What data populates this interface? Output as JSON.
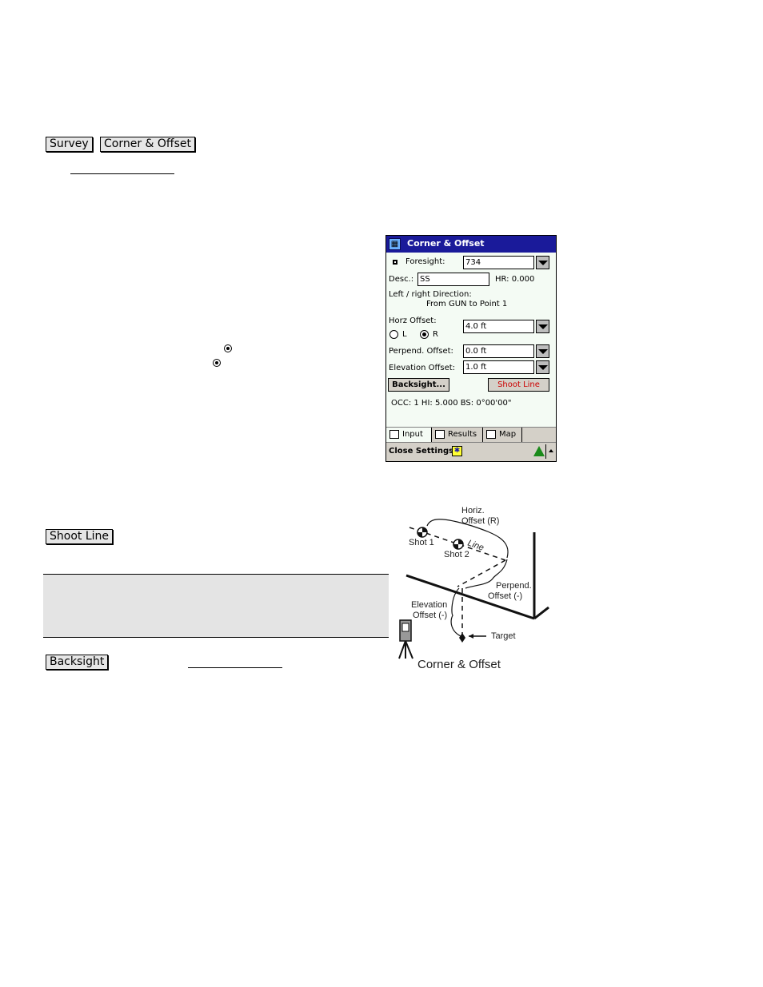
{
  "nav_buttons": {
    "survey": "Survey",
    "corner_offset": "Corner & Offset"
  },
  "inline_buttons": {
    "shoot_line": "Shoot Line",
    "backsight": "Backsight"
  },
  "device": {
    "title": "Corner & Offset",
    "foresight_label": "Foresight:",
    "foresight_value": "734",
    "desc_label": "Desc.:",
    "desc_value": "SS",
    "hr_text": "HR: 0.000",
    "lr_direction_label": "Left / right Direction:",
    "lr_direction_value": "From GUN to Point 1",
    "horz_offset_label": "Horz Offset:",
    "radio_left": "L",
    "radio_right": "R",
    "radio_selected": "R",
    "horz_offset_value": "4.0 ft",
    "perpend_offset_label": "Perpend. Offset:",
    "perpend_offset_value": "0.0 ft",
    "elevation_offset_label": "Elevation Offset:",
    "elevation_offset_value": "1.0 ft",
    "backsight_button": "Backsight...",
    "shoot_line_button": "Shoot Line",
    "status_line": "OCC: 1  HI: 5.000  BS: 0°00'00\"",
    "tabs": [
      {
        "label": "Input",
        "icon": "form-icon",
        "active": true
      },
      {
        "label": "Results",
        "icon": "results-icon",
        "active": false
      },
      {
        "label": "Map",
        "icon": "map-icon",
        "active": false
      }
    ],
    "close_settings": "Close Settings",
    "colors": {
      "titlebar": "#1a1a9a",
      "shoot_line_text": "#cc0000",
      "screen_bg": "#f4fbf4"
    }
  },
  "diagram": {
    "labels": {
      "horiz_offset_1": "Horiz.",
      "horiz_offset_2": "Offset (R)",
      "shot1": "Shot 1",
      "shot2": "Shot 2",
      "line": "Line",
      "perpend_1": "Perpend.",
      "perpend_2": "Offset (-)",
      "elevation_1": "Elevation",
      "elevation_2": "Offset (-)",
      "target": "Target"
    },
    "caption": "Corner & Offset"
  }
}
